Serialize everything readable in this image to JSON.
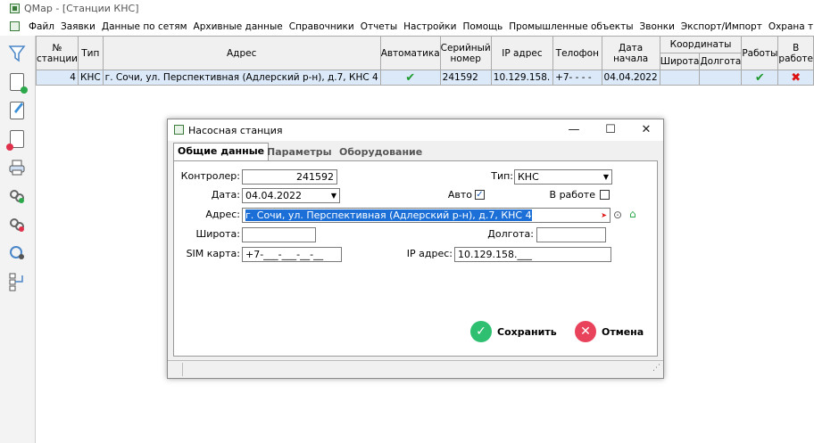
{
  "window": {
    "title": "QMap - [Станции КНС]"
  },
  "menu": [
    "Файл",
    "Заявки",
    "Данные по сетям",
    "Архивные данные",
    "Справочники",
    "Отчеты",
    "Настройки",
    "Помощь",
    "Промышленные объекты",
    "Звонки",
    "Экспорт/Импорт",
    "Охрана труда"
  ],
  "toolbar": [
    "filter-icon",
    "new-doc-icon",
    "edit-icon",
    "delete-doc-icon",
    "print-icon",
    "link-icon",
    "unlink-icon",
    "map-pin-icon",
    "tree-icon"
  ],
  "table": {
    "headers": {
      "num": "№ станции",
      "type": "Тип",
      "address": "Адрес",
      "auto": "Автоматика",
      "serial": "Серийный номер",
      "ip": "IP адрес",
      "phone": "Телофон",
      "date": "Дата начала",
      "coords": "Координаты",
      "lat": "Широта",
      "lon": "Долгота",
      "works": "Работы",
      "in_work": "В работе"
    },
    "row": {
      "num": "4",
      "type": "КНС",
      "address": "г. Сочи, ул. Перспективная (Адлерский р-н), д.7, КНС 4",
      "serial": "241592",
      "ip": "10.129.158.",
      "phone": "+7-  -  -  -",
      "date": "04.04.2022"
    }
  },
  "dialog": {
    "title": "Насосная станция",
    "tabs": [
      "Общие данные",
      "Параметры",
      "Оборудование"
    ],
    "controller_label": "Контролер:",
    "controller_value": "241592",
    "type_label": "Тип:",
    "type_value": "КНС",
    "date_label": "Дата:",
    "date_value": "04.04.2022",
    "auto_label": "Авто",
    "auto_checked": true,
    "in_work_label": "В работе",
    "in_work_checked": false,
    "address_label": "Адрес:",
    "address_value": "г. Сочи, ул. Перспективная (Адлерский р-н), д.7, КНС 4",
    "lat_label": "Широта:",
    "lat_value": "",
    "lon_label": "Долгота:",
    "lon_value": "",
    "sim_label": "SIM карта:",
    "sim_value": "+7-___-___-__-__",
    "ip_label": "IP адрес:",
    "ip_value": "10.129.158.___",
    "save_label": "Сохранить",
    "cancel_label": "Отмена",
    "colors": {
      "save": "#2fbf71",
      "cancel": "#e8435b",
      "selection": "#1b6fd6"
    }
  }
}
